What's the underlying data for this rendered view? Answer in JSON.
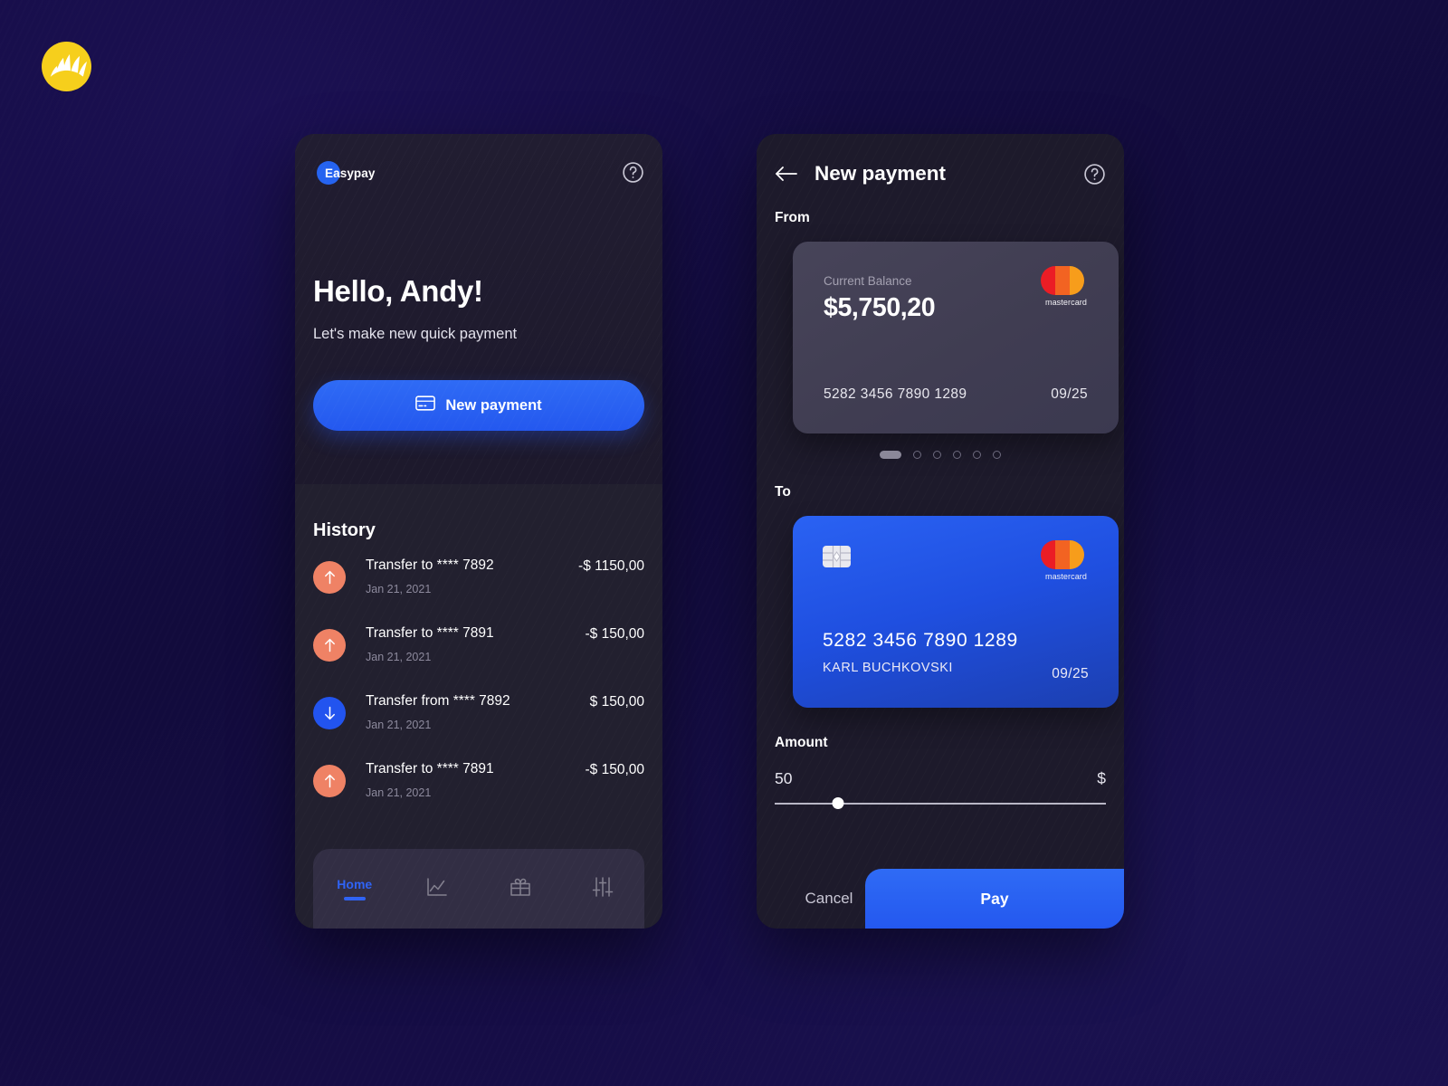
{
  "brand": {
    "logo_icon": "sunburst-crown-logo",
    "name": "Easypay"
  },
  "colors": {
    "background": "#120b3f",
    "accent_blue": "#2458ef",
    "outgoing_orange": "#ef8265",
    "card_surface": "#474459",
    "logo_yellow": "#f6cf1c"
  },
  "home": {
    "help_icon": "help-circle-icon",
    "greeting": "Hello, Andy!",
    "subtitle": "Let's make new quick payment",
    "new_payment_button": {
      "label": "New payment",
      "icon": "credit-card-icon"
    },
    "history": {
      "title": "History",
      "items": [
        {
          "direction": "out",
          "icon": "arrow-up-icon",
          "title": "Transfer to **** 7892",
          "date": "Jan 21, 2021",
          "amount": "-$ 1150,00"
        },
        {
          "direction": "out",
          "icon": "arrow-up-icon",
          "title": "Transfer to **** 7891",
          "date": "Jan 21, 2021",
          "amount": "-$ 150,00"
        },
        {
          "direction": "in",
          "icon": "arrow-down-icon",
          "title": "Transfer from **** 7892",
          "date": "Jan 21, 2021",
          "amount": "$ 150,00"
        },
        {
          "direction": "out",
          "icon": "arrow-up-icon",
          "title": "Transfer to **** 7891",
          "date": "Jan 21, 2021",
          "amount": "-$ 150,00"
        }
      ]
    },
    "nav": [
      {
        "label": "Home",
        "icon": "home-label",
        "active": true
      },
      {
        "label": "",
        "icon": "line-chart-icon",
        "active": false
      },
      {
        "label": "",
        "icon": "gift-icon",
        "active": false
      },
      {
        "label": "",
        "icon": "sliders-icon",
        "active": false
      }
    ]
  },
  "payment": {
    "back_icon": "arrow-left-icon",
    "help_icon": "help-circle-icon",
    "title": "New payment",
    "from_label": "From",
    "from_card": {
      "balance_label": "Current Balance",
      "balance": "$5,750,20",
      "number": "5282 3456 7890 1289",
      "expiry": "09/25",
      "network_icon": "mastercard-logo",
      "network_name": "mastercard"
    },
    "carousel": {
      "total": 6,
      "active_index": 0
    },
    "to_label": "To",
    "to_card": {
      "chip_icon": "emv-chip-icon",
      "number": "5282 3456 7890 1289",
      "holder": "KARL BUCHKOVSKI",
      "expiry": "09/25",
      "network_icon": "mastercard-logo",
      "network_name": "mastercard"
    },
    "amount": {
      "label": "Amount",
      "value": "50",
      "currency": "$",
      "slider_percent": 19
    },
    "cancel_button": "Cancel",
    "pay_button": "Pay"
  }
}
